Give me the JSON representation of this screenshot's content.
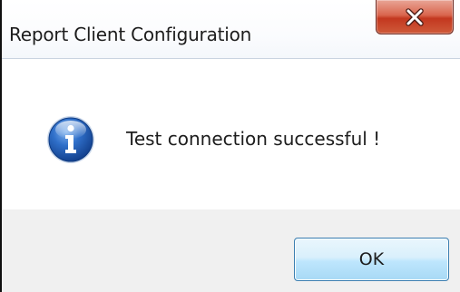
{
  "window": {
    "title": "Report Client Configuration",
    "close_icon": "close-icon"
  },
  "message": {
    "icon": "info-icon",
    "text": "Test connection successful !"
  },
  "buttons": {
    "ok_label": "OK"
  },
  "colors": {
    "close_button": "#c3381f",
    "info_icon": "#1f5fb5",
    "ok_button_border": "#3c7fb1",
    "footer_background": "#f0f0f0"
  }
}
